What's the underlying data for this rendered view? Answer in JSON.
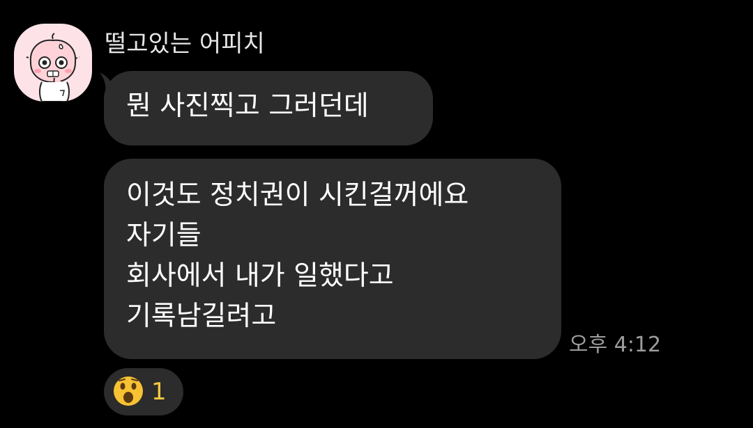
{
  "conversation": {
    "sender": {
      "name": "떨고있는 어피치",
      "avatar_icon": "apeach-trembling-avatar-icon"
    },
    "messages": [
      {
        "lines": [
          "뭔 사진찍고 그러던데"
        ]
      },
      {
        "lines": [
          "이것도 정치권이 시킨걸꺼에요",
          "자기들",
          "회사에서 내가 일했다고",
          "기록남길려고"
        ]
      }
    ],
    "timestamp": "오후 4:12",
    "reaction": {
      "emoji_icon": "surprised-face-icon",
      "count": "1"
    }
  },
  "colors": {
    "background": "#000000",
    "bubble": "#2c2c2c",
    "text": "#ffffff",
    "timestamp": "#9d9d9d",
    "reaction_count": "#f5c842",
    "avatar_bg": "#fde3e7"
  }
}
